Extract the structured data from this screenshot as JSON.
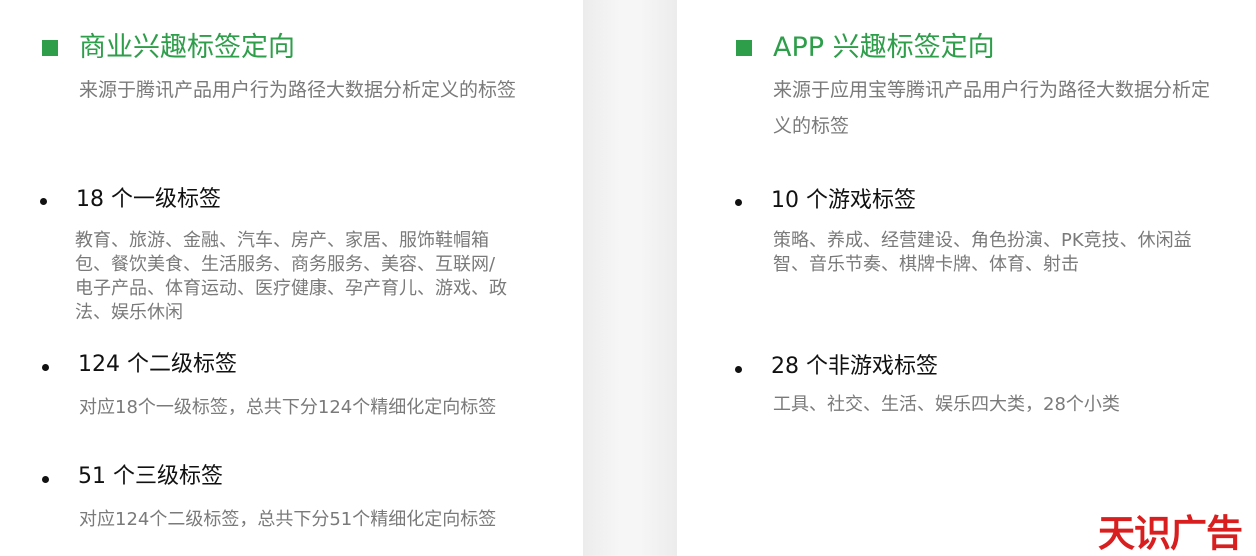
{
  "left": {
    "title": "商业兴趣标签定向",
    "subtitle": "来源于腾讯产品用户行为路径大数据分析定义的标签",
    "items": [
      {
        "title": "18 个一级标签",
        "desc": "教育、旅游、金融、汽车、房产、家居、服饰鞋帽箱包、餐饮美食、生活服务、商务服务、美容、互联网/电子产品、体育运动、医疗健康、孕产育儿、游戏、政法、娱乐休闲"
      },
      {
        "title": "124 个二级标签",
        "desc": "对应18个一级标签，总共下分124个精细化定向标签"
      },
      {
        "title": "51 个三级标签",
        "desc": "对应124个二级标签，总共下分51个精细化定向标签"
      }
    ]
  },
  "right": {
    "title": "APP 兴趣标签定向",
    "subtitle": "来源于应用宝等腾讯产品用户行为路径大数据分析定义的标签",
    "items": [
      {
        "title": "10 个游戏标签",
        "desc": "策略、养成、经营建设、角色扮演、PK竞技、休闲益智、音乐节奏、棋牌卡牌、体育、射击"
      },
      {
        "title": "28 个非游戏标签",
        "desc": "工具、社交、生活、娱乐四大类，28个小类"
      }
    ]
  },
  "watermark": "天识广告",
  "colors": {
    "accent": "#2e9e4a",
    "brand": "#d81e1e"
  }
}
